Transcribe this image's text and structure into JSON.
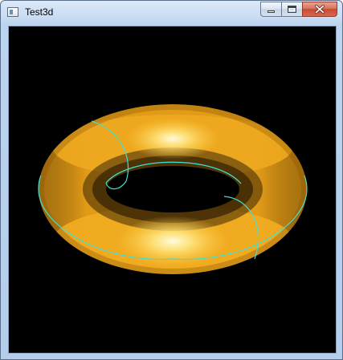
{
  "window": {
    "title": "Test3d",
    "icon": "app-window-icon"
  },
  "caption_buttons": {
    "minimize_icon": "minimize-icon",
    "maximize_icon": "maximize-icon",
    "close_icon": "close-icon"
  },
  "viewport": {
    "background_color": "#000000",
    "object": "torus",
    "surface_color": "#f2a71c",
    "highlight_color": "#fff6b0",
    "outline_color": "#40e0d0"
  }
}
